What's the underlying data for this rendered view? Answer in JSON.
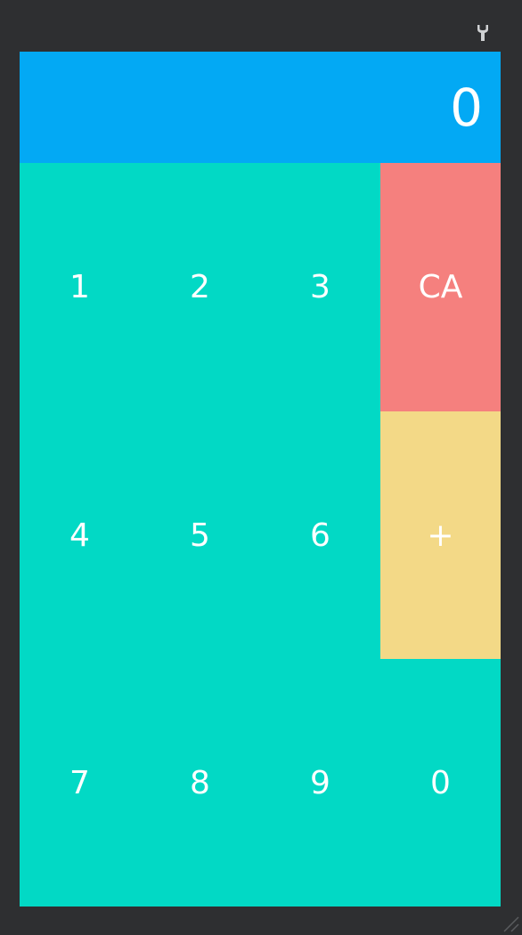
{
  "app": {
    "display": {
      "value": "0"
    },
    "keys": [
      {
        "label": "1"
      },
      {
        "label": "2"
      },
      {
        "label": "3"
      },
      {
        "label": "CA"
      },
      {
        "label": "4"
      },
      {
        "label": "5"
      },
      {
        "label": "6"
      },
      {
        "label": "+"
      },
      {
        "label": "7"
      },
      {
        "label": "8"
      },
      {
        "label": "9"
      },
      {
        "label": "0"
      }
    ],
    "colors": {
      "display_background": "#03a9f4",
      "keypad_background": "#02d9c5",
      "clear_all_key": "#f5807e",
      "plus_key": "#f3d987",
      "window_frame": "#2e2f31",
      "text": "#ffffff"
    }
  },
  "toolbar": {
    "icon": "wrench-icon"
  }
}
